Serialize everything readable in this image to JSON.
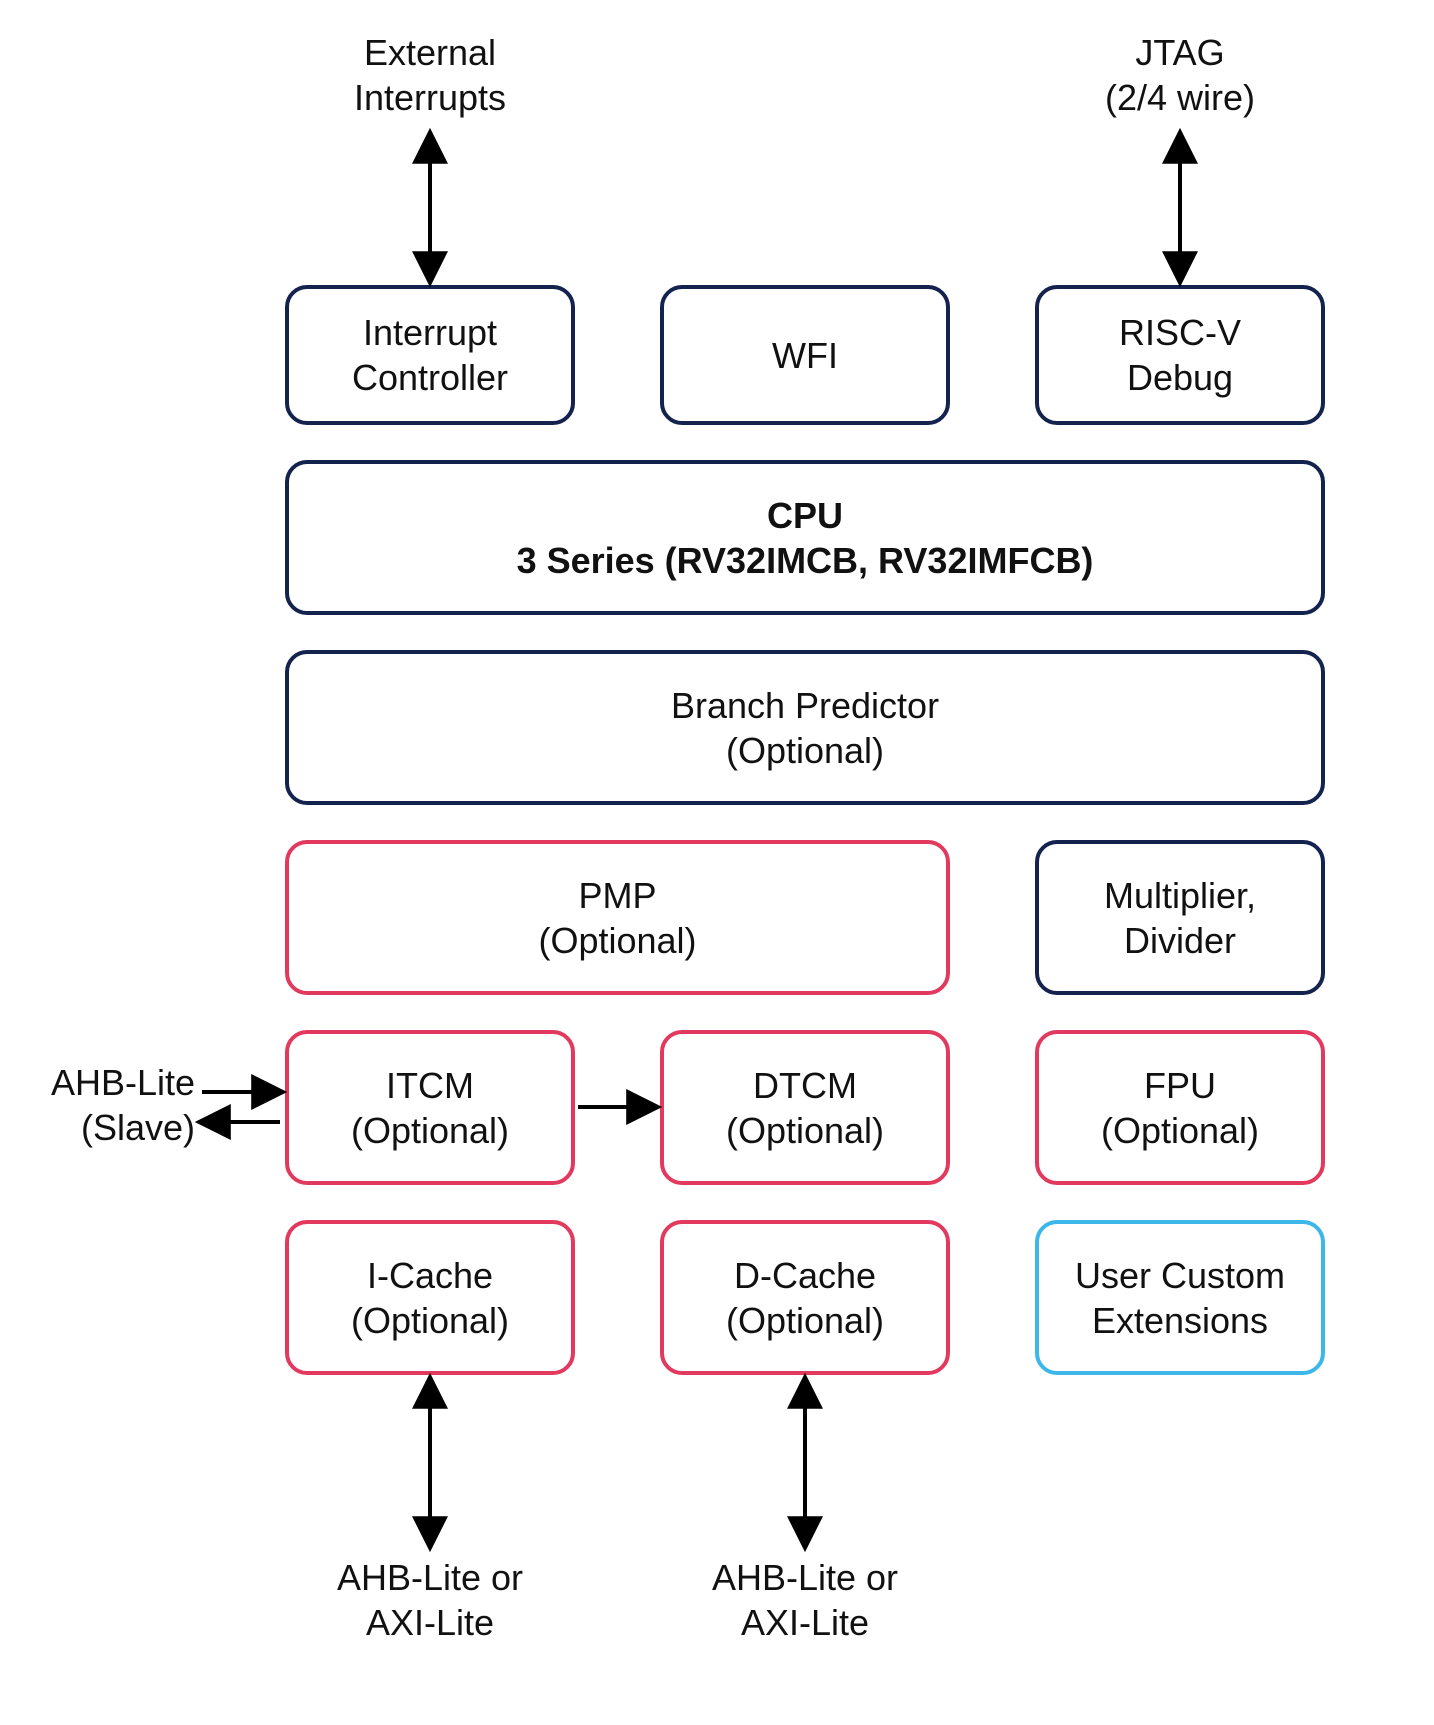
{
  "topLabels": {
    "externalInterrupts": {
      "l1": "External",
      "l2": "Interrupts"
    },
    "jtag": {
      "l1": "JTAG",
      "l2": "(2/4 wire)"
    }
  },
  "row1": {
    "interruptController": {
      "l1": "Interrupt",
      "l2": "Controller"
    },
    "wfi": "WFI",
    "riscvDebug": {
      "l1": "RISC-V",
      "l2": "Debug"
    }
  },
  "cpu": {
    "l1": "CPU",
    "l2": "3 Series (RV32IMCB, RV32IMFCB)"
  },
  "branchPredictor": {
    "l1": "Branch Predictor",
    "l2": "(Optional)"
  },
  "row4": {
    "pmp": {
      "l1": "PMP",
      "l2": "(Optional)"
    },
    "multDiv": {
      "l1": "Multiplier,",
      "l2": "Divider"
    }
  },
  "row5": {
    "itcm": {
      "l1": "ITCM",
      "l2": "(Optional)"
    },
    "dtcm": {
      "l1": "DTCM",
      "l2": "(Optional)"
    },
    "fpu": {
      "l1": "FPU",
      "l2": "(Optional)"
    }
  },
  "row6": {
    "icache": {
      "l1": "I-Cache",
      "l2": "(Optional)"
    },
    "dcache": {
      "l1": "D-Cache",
      "l2": "(Optional)"
    },
    "uce": {
      "l1": "User Custom",
      "l2": "Extensions"
    }
  },
  "sideLabel": {
    "l1": "AHB-Lite",
    "l2": "(Slave)"
  },
  "bottomLabels": {
    "left": {
      "l1": "AHB-Lite or",
      "l2": "AXI-Lite"
    },
    "right": {
      "l1": "AHB-Lite or",
      "l2": "AXI-Lite"
    }
  }
}
